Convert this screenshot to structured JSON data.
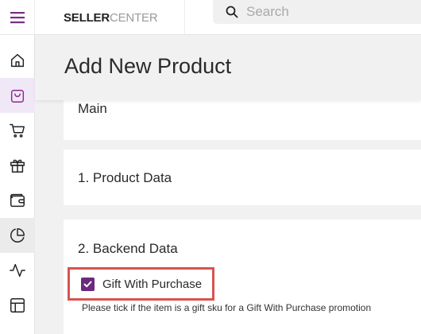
{
  "header": {
    "logo_bold": "SELLER",
    "logo_light": "CENTER",
    "search_placeholder": "Search"
  },
  "sidebar": {
    "items": [
      {
        "icon": "home-icon"
      },
      {
        "icon": "shopping-bag-icon",
        "state": "active"
      },
      {
        "icon": "shopping-cart-icon"
      },
      {
        "icon": "gift-icon"
      },
      {
        "icon": "wallet-icon"
      },
      {
        "icon": "pie-chart-icon",
        "state": "selected"
      },
      {
        "icon": "activity-icon"
      },
      {
        "icon": "layout-icon"
      }
    ]
  },
  "page": {
    "title": "Add New Product"
  },
  "sections": {
    "main_label": "Main",
    "product_data_label": "1. Product Data",
    "backend_data_label": "2. Backend Data"
  },
  "gift_with_purchase": {
    "label": "Gift With Purchase",
    "checked": true,
    "hint": "Please tick if the item is a gift sku for a Gift With Purchase promotion"
  },
  "colors": {
    "accent": "#6b2a7c",
    "active_icon": "#8a2a8a",
    "highlight_border": "#d9534f"
  }
}
